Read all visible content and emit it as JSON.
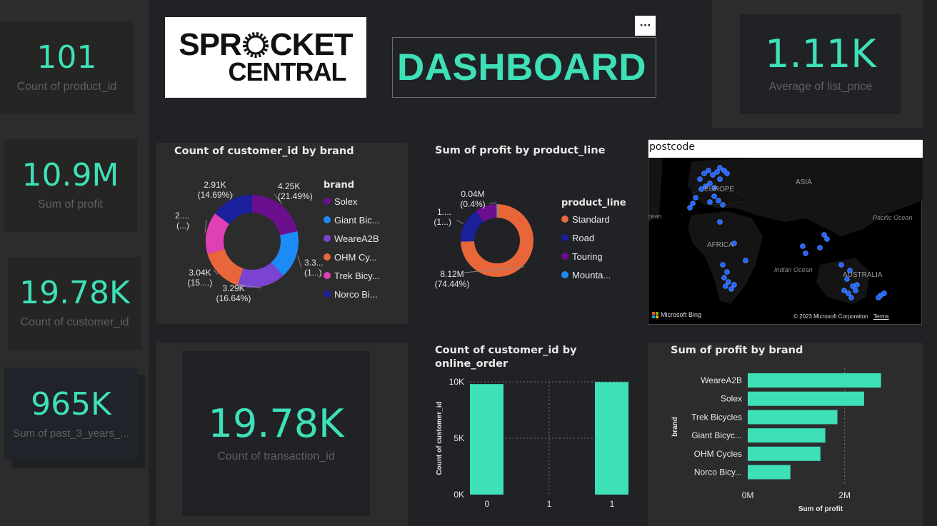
{
  "kpis": {
    "product_count": {
      "value": "101",
      "label": "Count of product_id"
    },
    "profit_sum": {
      "value": "10.9M",
      "label": "Sum of profit"
    },
    "customer_count": {
      "value": "19.78K",
      "label": "Count of customer_id"
    },
    "past3_sum": {
      "value": "965K",
      "label": "Sum of past_3_years_..."
    },
    "transaction_count": {
      "value": "19.78K",
      "label": "Count of transaction_id"
    },
    "list_price_avg": {
      "value": "1.11K",
      "label": "Average of list_price"
    }
  },
  "logo": {
    "line1": "SPR",
    "line1b": "CKET",
    "line2": "CENTRAL"
  },
  "header": {
    "title": "DASHBOARD",
    "more_label": "···"
  },
  "colors": {
    "accent": "#3ee0b8",
    "solex": "#6b0f8e",
    "giant": "#1d8bf7",
    "weare": "#7a43d0",
    "ohm": "#e8663a",
    "trek": "#e040b6",
    "norco": "#1a1f9c"
  },
  "map": {
    "title": "postcode",
    "labels": {
      "europe": "EUROPE",
      "asia": "ASIA",
      "africa": "AFRICA",
      "australia": "AUSTRALIA",
      "pacific": "Pacific Ocean",
      "indian": "Indian Ocean",
      "atlantic": "Atlantic Ocean"
    },
    "bing": "Microsoft Bing",
    "copyright": "© 2023 Microsoft Corporation",
    "terms": "Terms"
  },
  "chart_data": [
    {
      "type": "pie",
      "title": "Count of customer_id by brand",
      "legend_title": "brand",
      "legend": [
        "Solex",
        "Giant Bic...",
        "WeareA2B",
        "OHM Cy...",
        "Trek Bicy...",
        "Norco Bi..."
      ],
      "categories": [
        "Solex",
        "Giant Bicycles",
        "WeareA2B",
        "OHM Cycles",
        "Trek Bicycles",
        "Norco Bicycles"
      ],
      "values": [
        4250,
        3300,
        3290,
        3040,
        2900,
        2910
      ],
      "data_labels": [
        [
          "4.25K",
          "(21.49%)"
        ],
        [
          "3.3...",
          "(1...)"
        ],
        [
          "3.29K",
          "(16.64%)"
        ],
        [
          "3.04K",
          "(15....)"
        ],
        [
          "2....",
          "(...)"
        ],
        [
          "2.91K",
          "(14.69%)"
        ]
      ]
    },
    {
      "type": "pie",
      "title": "Sum of profit by product_line",
      "legend_title": "product_line",
      "legend": [
        "Standard",
        "Road",
        "Touring",
        "Mounta..."
      ],
      "categories": [
        "Standard",
        "Road",
        "Touring",
        "Mountain"
      ],
      "values": [
        8.12,
        1.7,
        1.04,
        0.04
      ],
      "data_labels": [
        [
          "8.12M",
          "(74.44%)"
        ],
        [
          "1....",
          "(1...)"
        ],
        [
          "",
          ""
        ],
        [
          "0.04M",
          "(0.4%)"
        ]
      ]
    },
    {
      "type": "bar",
      "title": "Count of customer_id by",
      "title2": "online_order",
      "categories": [
        "0",
        "1"
      ],
      "mid_tick": "1",
      "values": [
        9800,
        9980
      ],
      "ylabel": "Count of customer_id",
      "ylim": [
        0,
        10000
      ],
      "yticks": [
        "0K",
        "5K",
        "10K"
      ]
    },
    {
      "type": "bar",
      "title": "Sum of profit by brand",
      "categories": [
        "WeareA2B",
        "Solex",
        "Trek Bicycles",
        "Giant Bicyc...",
        "OHM Cycles",
        "Norco Bicy..."
      ],
      "values": [
        2.75,
        2.4,
        1.85,
        1.6,
        1.5,
        0.88
      ],
      "xlabel": "Sum of profit",
      "ylabel": "brand",
      "xlim": [
        0,
        2.8
      ],
      "xticks": [
        "0M",
        "2M"
      ]
    }
  ]
}
